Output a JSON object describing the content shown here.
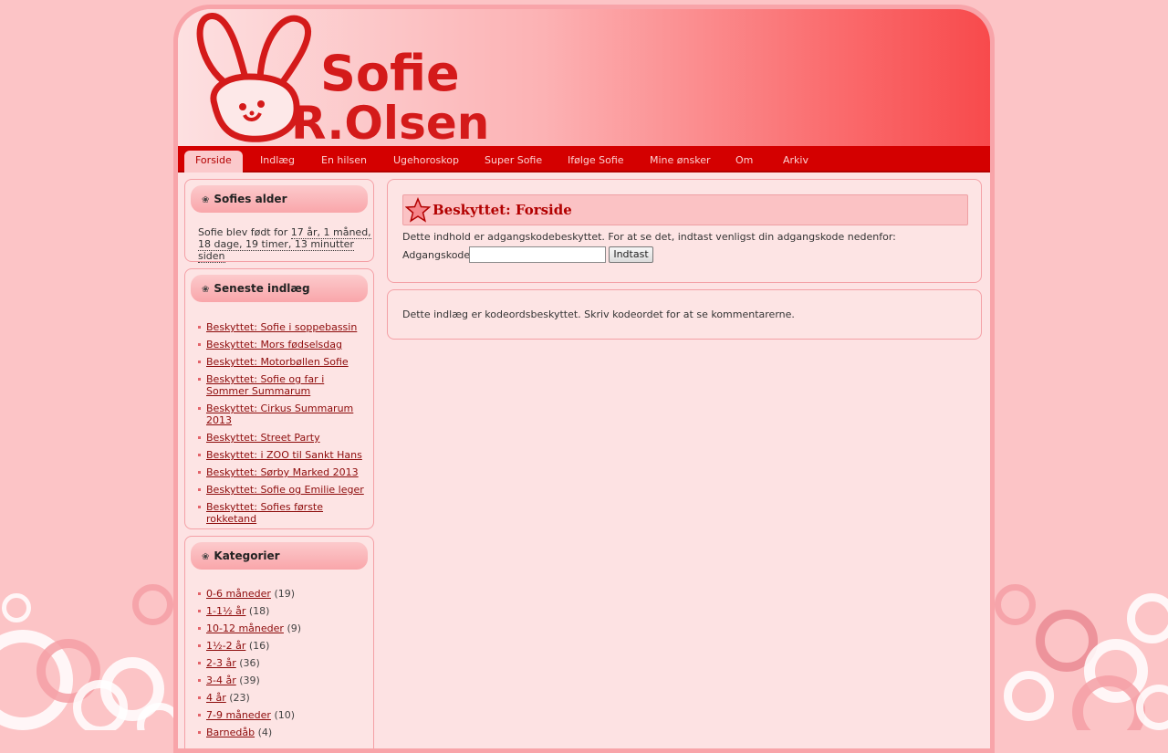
{
  "header": {
    "logo_line1": "Sofie",
    "logo_line2": "R.Olsen"
  },
  "nav": [
    {
      "label": "Forside",
      "active": true
    },
    {
      "label": "Indlæg"
    },
    {
      "label": "En hilsen"
    },
    {
      "label": "Ugehoroskop"
    },
    {
      "label": "Super Sofie"
    },
    {
      "label": "Ifølge Sofie"
    },
    {
      "label": "Mine ønsker"
    },
    {
      "label": "Om"
    },
    {
      "label": "Arkiv"
    }
  ],
  "sidebar": {
    "age": {
      "title": "Sofies alder",
      "text_prefix": "Sofie blev født for",
      "age_line1": "17 år, 1 måned,",
      "age_line2": "18 dage, 19 timer, 13 minutter siden"
    },
    "recent": {
      "title": "Seneste indlæg",
      "items": [
        "Beskyttet: Sofie i soppebassin",
        "Beskyttet: Mors fødselsdag",
        "Beskyttet: Motorbøllen Sofie",
        "Beskyttet: Sofie og far i Sommer Summarum",
        "Beskyttet: Cirkus Summarum 2013",
        "Beskyttet: Street Party",
        "Beskyttet: i ZOO til Sankt Hans",
        "Beskyttet: Sørby Marked 2013",
        "Beskyttet: Sofie og Emilie leger",
        "Beskyttet: Sofies første rokketand"
      ]
    },
    "categories": {
      "title": "Kategorier",
      "items": [
        {
          "label": "0-6 måneder",
          "count": "(19)"
        },
        {
          "label": "1-1½ år",
          "count": "(18)"
        },
        {
          "label": "10-12 måneder",
          "count": "(9)"
        },
        {
          "label": "1½-2 år",
          "count": "(16)"
        },
        {
          "label": "2-3 år",
          "count": "(36)"
        },
        {
          "label": "3-4 år",
          "count": "(39)"
        },
        {
          "label": "4 år",
          "count": "(23)"
        },
        {
          "label": "7-9 måneder",
          "count": "(10)"
        },
        {
          "label": "Barnedåb",
          "count": "(4)"
        }
      ]
    }
  },
  "post": {
    "title": "Beskyttet: Forside",
    "protected_text": "Dette indhold er adgangskodebeskyttet. For at se det, indtast venligst din adgangskode nedenfor:",
    "password_label": "Adgangskode:",
    "password_value": "",
    "submit_label": "Indtast"
  },
  "comments": {
    "text": "Dette indlæg er kodeordsbeskyttet. Skriv kodeordet for at se kommentarerne."
  },
  "colors": {
    "accent": "#d40000",
    "title_red": "#b20000",
    "link": "#8d0b0b",
    "background": "#fcc4c6"
  }
}
